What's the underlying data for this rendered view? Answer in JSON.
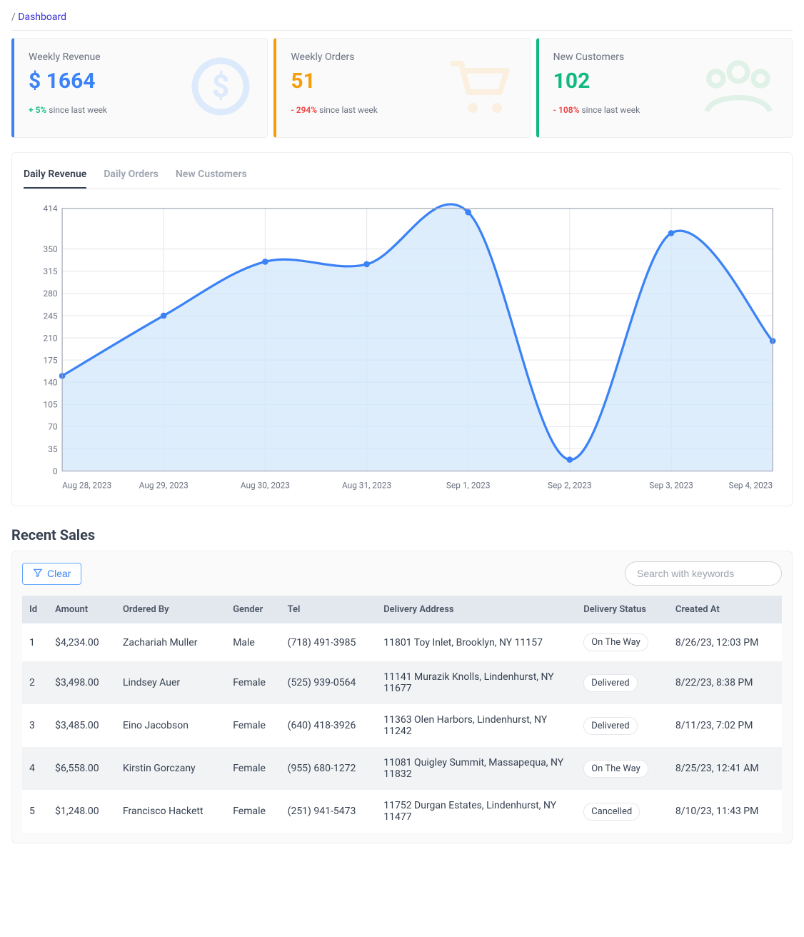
{
  "breadcrumb": {
    "separator": "/",
    "current": "Dashboard"
  },
  "stats": {
    "revenue": {
      "title": "Weekly Revenue",
      "value": "$ 1664",
      "delta": "+ 5%",
      "delta_dir": "up",
      "suffix": "since last week"
    },
    "orders": {
      "title": "Weekly Orders",
      "value": "51",
      "delta": "- 294%",
      "delta_dir": "down",
      "suffix": "since last week"
    },
    "customers": {
      "title": "New Customers",
      "value": "102",
      "delta": "- 108%",
      "delta_dir": "down",
      "suffix": "since last week"
    }
  },
  "chart_tabs": {
    "t0": "Daily Revenue",
    "t1": "Daily Orders",
    "t2": "New Customers"
  },
  "chart_data": {
    "type": "area",
    "categories": [
      "Aug 28, 2023",
      "Aug 29, 2023",
      "Aug 30, 2023",
      "Aug 31, 2023",
      "Sep 1, 2023",
      "Sep 2, 2023",
      "Sep 3, 2023",
      "Sep 4, 2023"
    ],
    "values": [
      150,
      245,
      330,
      326,
      408,
      18,
      375,
      205
    ],
    "yticks": [
      0,
      35,
      70,
      105,
      140,
      175,
      210,
      245,
      280,
      315,
      350,
      414
    ],
    "ylim": [
      0,
      414
    ]
  },
  "recent_sales": {
    "title": "Recent Sales",
    "clear_label": "Clear",
    "search_placeholder": "Search with keywords",
    "columns": {
      "c0": "Id",
      "c1": "Amount",
      "c2": "Ordered By",
      "c3": "Gender",
      "c4": "Tel",
      "c5": "Delivery Address",
      "c6": "Delivery Status",
      "c7": "Created At"
    },
    "rows": [
      {
        "id": "1",
        "amount": "$4,234.00",
        "by": "Zachariah Muller",
        "gender": "Male",
        "tel": "(718) 491-3985",
        "addr": "11801 Toy Inlet, Brooklyn, NY 11157",
        "status": "On The Way",
        "created": "8/26/23, 12:03 PM"
      },
      {
        "id": "2",
        "amount": "$3,498.00",
        "by": "Lindsey Auer",
        "gender": "Female",
        "tel": "(525) 939-0564",
        "addr": "11141 Murazik Knolls, Lindenhurst, NY 11677",
        "status": "Delivered",
        "created": "8/22/23, 8:38 PM"
      },
      {
        "id": "3",
        "amount": "$3,485.00",
        "by": "Eino Jacobson",
        "gender": "Female",
        "tel": "(640) 418-3926",
        "addr": "11363 Olen Harbors, Lindenhurst, NY 11242",
        "status": "Delivered",
        "created": "8/11/23, 7:02 PM"
      },
      {
        "id": "4",
        "amount": "$6,558.00",
        "by": "Kirstin Gorczany",
        "gender": "Female",
        "tel": "(955) 680-1272",
        "addr": "11081 Quigley Summit, Massapequa, NY 11832",
        "status": "On The Way",
        "created": "8/25/23, 12:41 AM"
      },
      {
        "id": "5",
        "amount": "$1,248.00",
        "by": "Francisco Hackett",
        "gender": "Female",
        "tel": "(251) 941-5473",
        "addr": "11752 Durgan Estates, Lindenhurst, NY 11477",
        "status": "Cancelled",
        "created": "8/10/23, 11:43 PM"
      }
    ]
  }
}
